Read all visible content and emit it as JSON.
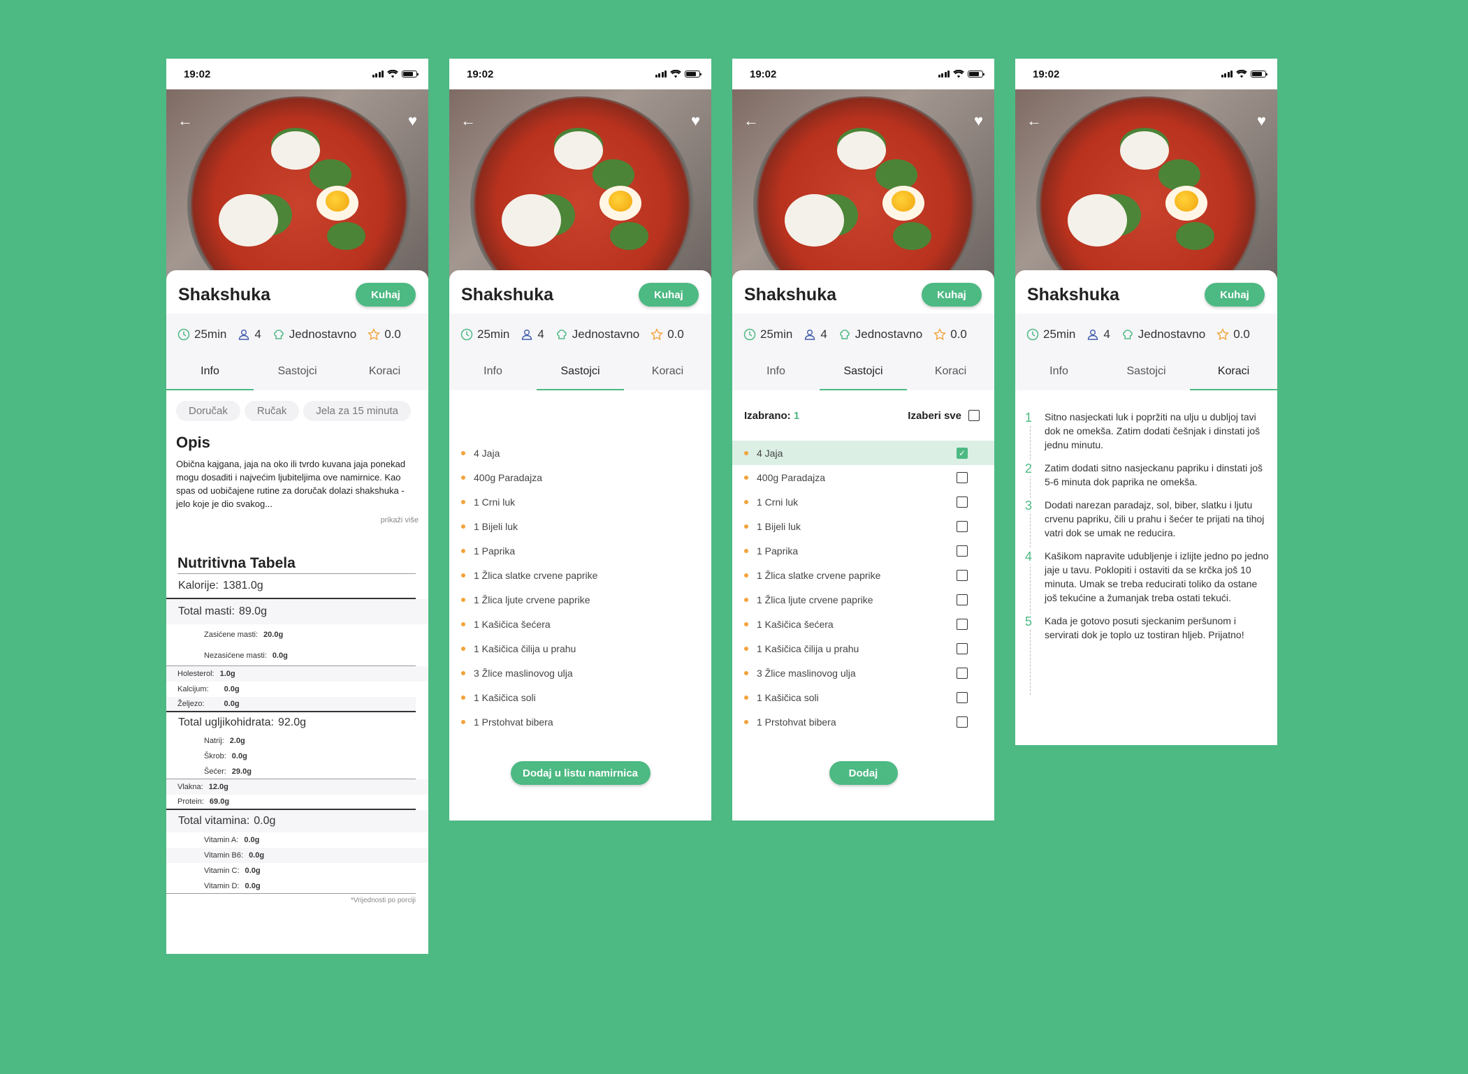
{
  "status_time": "19:02",
  "recipe": {
    "title": "Shakshuka",
    "cook_label": "Kuhaj",
    "time": "25min",
    "servings": "4",
    "difficulty": "Jednostavno",
    "rating": "0.0"
  },
  "tabs": [
    "Info",
    "Sastojci",
    "Koraci"
  ],
  "info": {
    "chips": [
      "Doručak",
      "Ručak",
      "Jela za 15 minuta"
    ],
    "opis_title": "Opis",
    "opis_text": "Obična kajgana, jaja na oko ili tvrdo kuvana jaja ponekad mogu dosaditi i najvećim ljubiteljima ove namirnice. Kao spas od uobičajene rutine za doručak dolazi shakshuka - jelo koje je dio svakog...",
    "show_more": "prikaži više",
    "nutrition_title": "Nutritivna Tabela",
    "nutrition": {
      "kalorije": {
        "label": "Kalorije:",
        "value": "1381.0g"
      },
      "total_masti": {
        "label": "Total masti:",
        "value": "89.0g"
      },
      "zasicene": {
        "label": "Zasićene masti:",
        "value": "20.0g"
      },
      "nezasicene": {
        "label": "Nezasićene masti:",
        "value": "0.0g"
      },
      "holesterol": {
        "label": "Holesterol:",
        "value": "1.0g"
      },
      "kalcijum": {
        "label": "Kalcijum:",
        "value": "0.0g"
      },
      "zeljezo": {
        "label": "Željezo:",
        "value": "0.0g"
      },
      "ugljikohidrati": {
        "label": "Total ugljikohidrata:",
        "value": "92.0g"
      },
      "natrij": {
        "label": "Natrij:",
        "value": "2.0g"
      },
      "skrob": {
        "label": "Škrob:",
        "value": "0.0g"
      },
      "secer": {
        "label": "Šećer:",
        "value": "29.0g"
      },
      "vlakna": {
        "label": "Vlakna:",
        "value": "12.0g"
      },
      "protein": {
        "label": "Protein:",
        "value": "69.0g"
      },
      "vitamini": {
        "label": "Total vitamina:",
        "value": "0.0g"
      },
      "vit_a": {
        "label": "Vitamin A:",
        "value": "0.0g"
      },
      "vit_b6": {
        "label": "Vitamin B6:",
        "value": "0.0g"
      },
      "vit_c": {
        "label": "Vitamin C:",
        "value": "0.0g"
      },
      "vit_d": {
        "label": "Vitamin D:",
        "value": "0.0g"
      }
    },
    "footnote": "*Vrijednosti po porciji"
  },
  "ingredients": [
    "4 Jaja",
    "400g Paradajza",
    "1 Crni luk",
    "1 Bijeli luk",
    "1 Paprika",
    "1 Žlica slatke crvene paprike",
    "1 Žlica ljute crvene paprike",
    "1 Kašičica šećera",
    "1 Kašičica čilija u prahu",
    "3 Žlice maslinovog ulja",
    "1 Kašičica soli",
    "1 Prstohvat bibera"
  ],
  "add_to_list_label": "Dodaj u listu namirnica",
  "selection": {
    "selected_label": "Izabrano:",
    "selected_count": "1",
    "select_all_label": "Izaberi sve",
    "checked": [
      true,
      false,
      false,
      false,
      false,
      false,
      false,
      false,
      false,
      false,
      false,
      false
    ],
    "add_label": "Dodaj"
  },
  "steps": [
    {
      "n": "1",
      "text": "Sitno nasjeckati luk i popržiti na ulju u dubljoj tavi dok ne omekša. Zatim dodati češnjak i dinstati još jednu minutu."
    },
    {
      "n": "2",
      "text": "Zatim dodati sitno nasjeckanu papriku i dinstati još 5-6 minuta dok paprika ne omekša."
    },
    {
      "n": "3",
      "text": "Dodati narezan paradajz, sol, biber, slatku i ljutu crvenu papriku, čili u prahu i šećer te prijati na tihoj vatri dok se umak ne reducira."
    },
    {
      "n": "4",
      "text": "Kašikom napravite udubljenje i izlijte jedno po jedno jaje u tavu. Poklopiti i ostaviti da se krčka još 10 minuta. Umak se treba reducirati toliko da ostane još tekućine a žumanjak treba ostati tekući."
    },
    {
      "n": "5",
      "text": "Kada je gotovo posuti sjeckanim peršunom i servirati dok je toplo uz tostiran hljeb. Prijatno!"
    }
  ],
  "icons": {
    "back": "arrow-left-icon",
    "favorite": "heart-icon",
    "time": "clock-icon",
    "servings": "person-icon",
    "difficulty": "chef-hat-icon",
    "rating": "star-icon"
  },
  "colors": {
    "brand": "#4db983",
    "bullet": "#f2a33a",
    "selected_row": "#dbefe5"
  }
}
